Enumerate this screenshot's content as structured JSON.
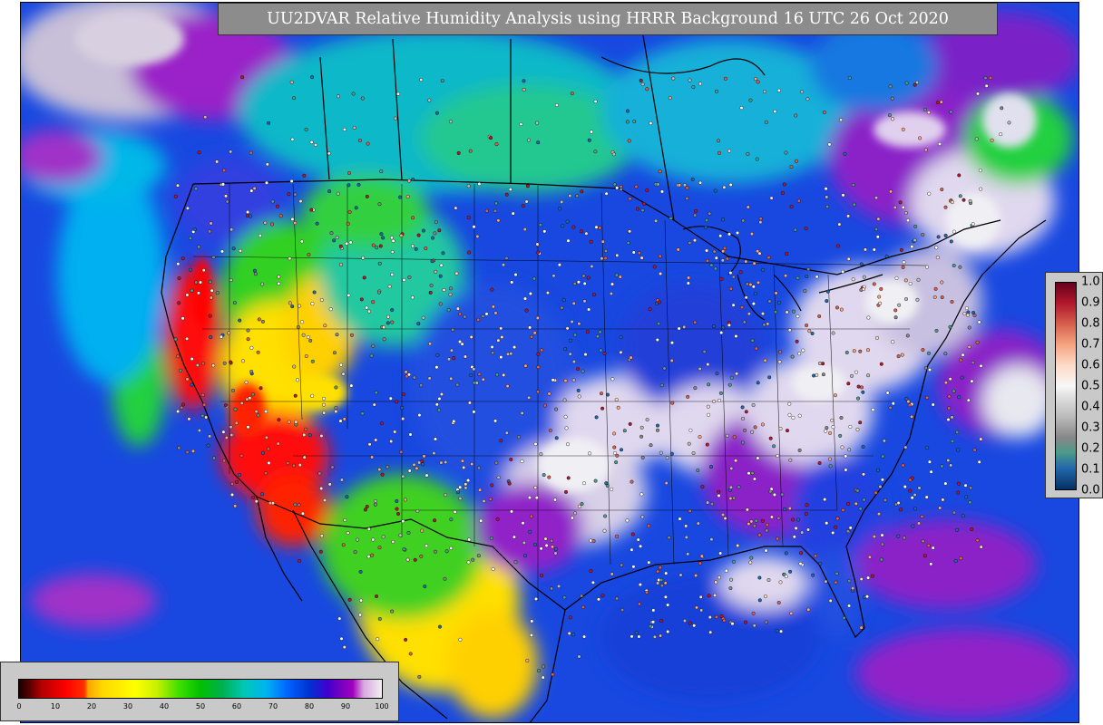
{
  "title": "UU2DVAR Relative Humidity Analysis using HRRR Background 16 UTC 26 Oct 2020",
  "bottom_legend": {
    "ticks": [
      "0",
      "10",
      "20",
      "30",
      "40",
      "50",
      "60",
      "70",
      "80",
      "90",
      "100"
    ]
  },
  "right_legend": {
    "ticks": [
      "1.0",
      "0.9",
      "0.8",
      "0.7",
      "0.6",
      "0.5",
      "0.4",
      "0.3",
      "0.2",
      "0.1",
      "0.0"
    ]
  },
  "colors": {
    "ocean": "#1a5fe0",
    "dry_red": "#ff0000",
    "yellow": "#ffe000",
    "green": "#20d020",
    "cyan": "#00c8d8",
    "purple": "#7a10c8",
    "white": "#e8e8ee",
    "panel_gray": "#c9c9c9",
    "title_gray": "#8c8c8c"
  }
}
